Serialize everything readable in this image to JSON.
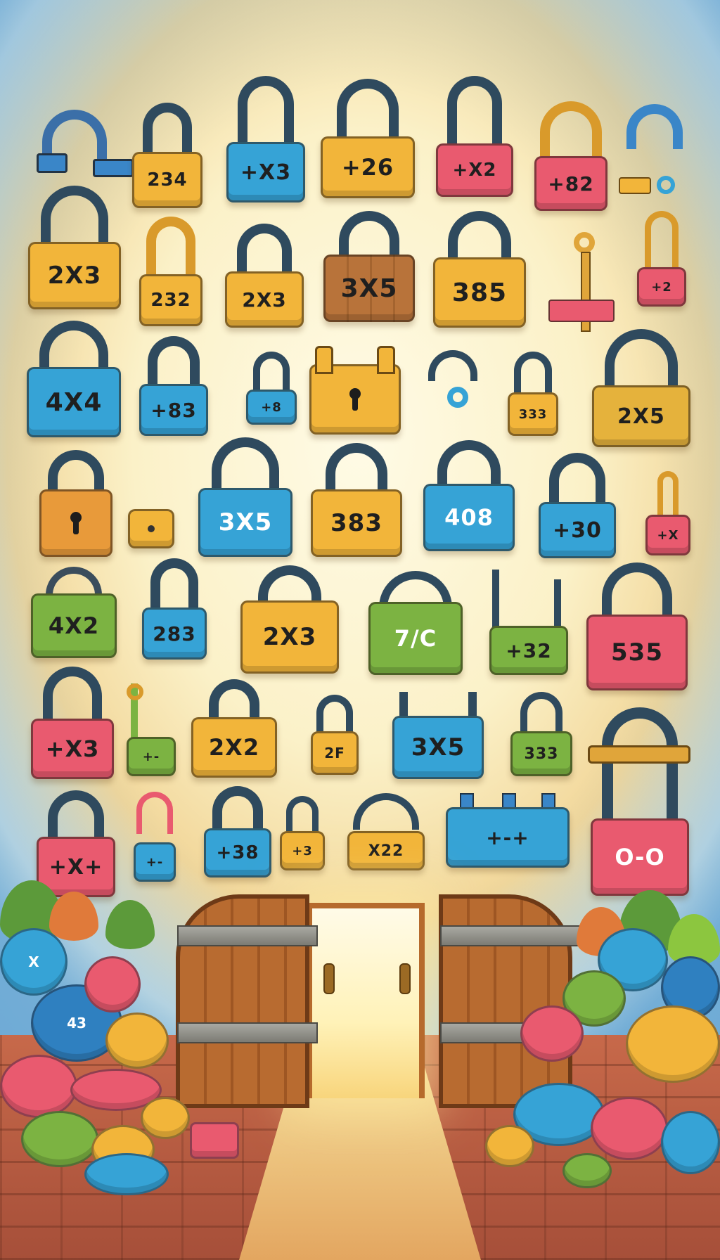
{
  "scene": {
    "description_labels": true
  },
  "colors": {
    "navy": "#2f4a5e",
    "yellow": "#f2b53a",
    "blue": "#36a3d6",
    "pink": "#e95a6f",
    "green": "#7cb342",
    "wood": "#b8733a",
    "orange": "#e89a3a"
  },
  "locks": [
    {
      "label": "234"
    },
    {
      "label": "+X3"
    },
    {
      "label": "+26"
    },
    {
      "label": "+X2"
    },
    {
      "label": "+82"
    },
    {
      "label": "2X3"
    },
    {
      "label": "232"
    },
    {
      "label": "2X3"
    },
    {
      "label": "3X5"
    },
    {
      "label": "385"
    },
    {
      "label": "+2"
    },
    {
      "label": "4X4"
    },
    {
      "label": "+83"
    },
    {
      "label": "+8"
    },
    {
      "label": "333"
    },
    {
      "label": "2X5"
    },
    {
      "label": "3X5"
    },
    {
      "label": "383"
    },
    {
      "label": "408"
    },
    {
      "label": "+30"
    },
    {
      "label": "+X"
    },
    {
      "label": "4X2"
    },
    {
      "label": "283"
    },
    {
      "label": "2X3"
    },
    {
      "label": "7/C"
    },
    {
      "label": "+32"
    },
    {
      "label": "535"
    },
    {
      "label": "+X3"
    },
    {
      "label": "+-"
    },
    {
      "label": "2X2"
    },
    {
      "label": "2F"
    },
    {
      "label": "3X5"
    },
    {
      "label": "333"
    },
    {
      "label": "+X+"
    },
    {
      "label": "+-"
    },
    {
      "label": "+38"
    },
    {
      "label": "+3"
    },
    {
      "label": "X22"
    },
    {
      "label": "+-+"
    },
    {
      "label": "O-O"
    }
  ],
  "pebbles": [
    {
      "label": "X"
    },
    {
      "label": "43"
    }
  ]
}
